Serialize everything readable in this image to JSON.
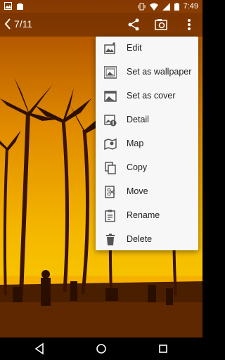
{
  "status_bar": {
    "time": "7:49"
  },
  "top_bar": {
    "counter": "7/11"
  },
  "menu": {
    "items": [
      {
        "label": "Edit",
        "icon": "edit-icon"
      },
      {
        "label": "Set as wallpaper",
        "icon": "wallpaper-icon"
      },
      {
        "label": "Set as cover",
        "icon": "cover-icon"
      },
      {
        "label": "Detail",
        "icon": "detail-icon"
      },
      {
        "label": "Map",
        "icon": "map-icon"
      },
      {
        "label": "Copy",
        "icon": "copy-icon"
      },
      {
        "label": "Move",
        "icon": "move-icon"
      },
      {
        "label": "Rename",
        "icon": "rename-icon"
      },
      {
        "label": "Delete",
        "icon": "delete-icon"
      }
    ]
  },
  "colors": {
    "sky_top": "#c86a00",
    "sky_mid": "#f0a800",
    "ground": "#3a1800",
    "menu_bg": "#f7f7f7"
  }
}
